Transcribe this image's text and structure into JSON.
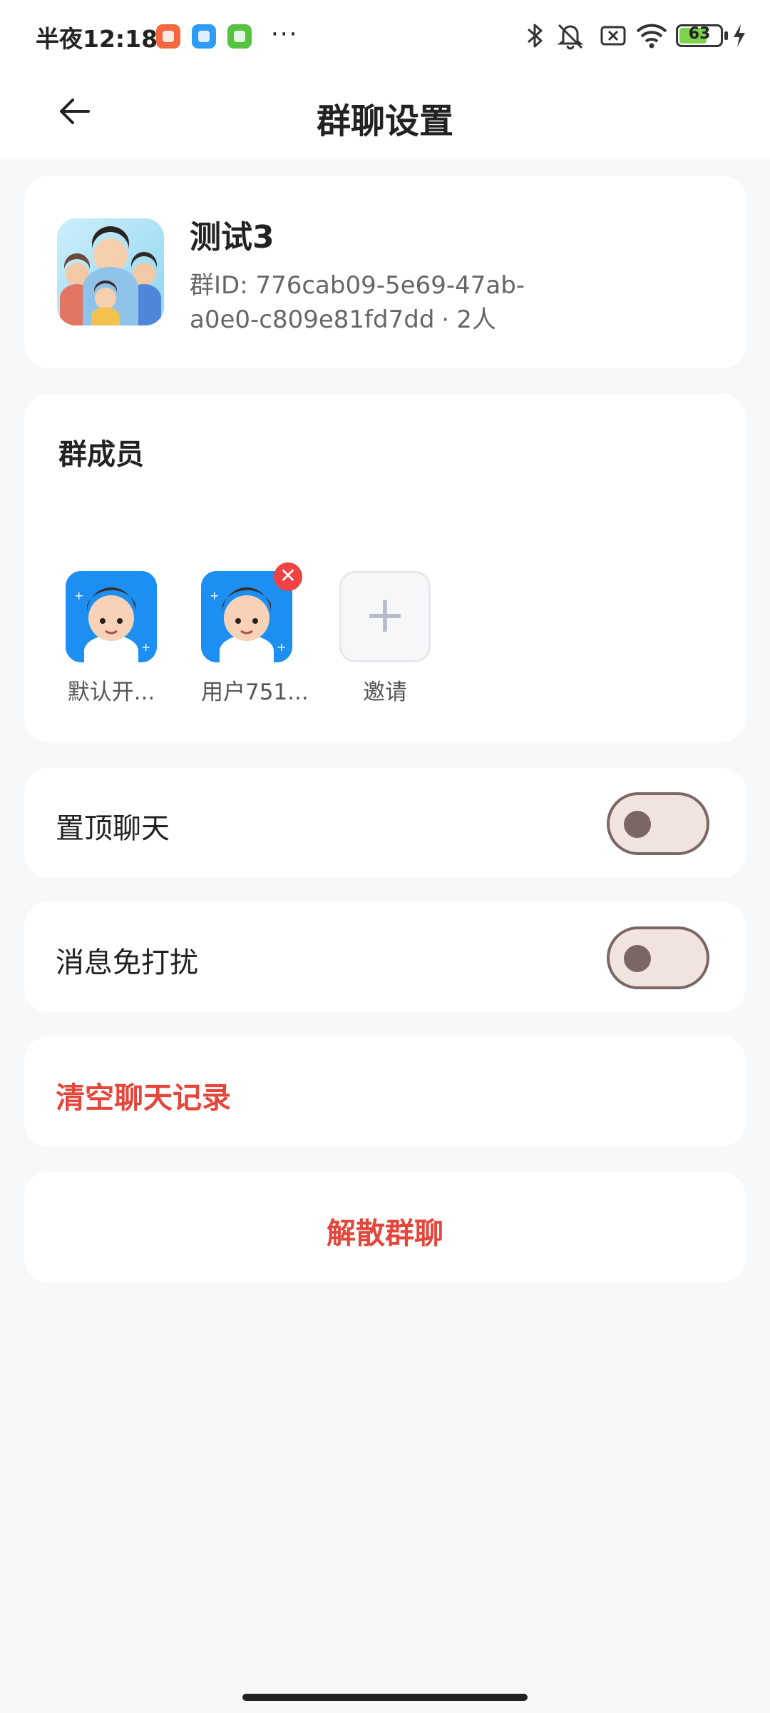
{
  "status_bar": {
    "time": "半夜12:18",
    "more": "···",
    "battery_level": "63",
    "battery_fraction": 0.63,
    "icons": [
      "app-notification-icon",
      "app-notification-icon",
      "app-notification-icon",
      "bluetooth-icon",
      "muted-bell-icon",
      "sim-off-icon",
      "wifi-icon",
      "battery-icon",
      "charging-icon"
    ]
  },
  "header": {
    "title": "群聊设置",
    "back_icon": "back-arrow-icon"
  },
  "group": {
    "name": "测试3",
    "id_label": "群ID: 776cab09-5e69-47ab-a0e0-c809e81fd7dd",
    "separator": "·",
    "member_count": "2人"
  },
  "members": {
    "title": "群成员",
    "items": [
      {
        "name": "默认开..."
      },
      {
        "name": "用户751..."
      }
    ],
    "invite_label": "邀请",
    "invite_symbol": "+",
    "remove_symbol": "✕"
  },
  "settings": {
    "pin_label": "置顶聊天",
    "pin_on": false,
    "mute_label": "消息免打扰",
    "mute_on": false
  },
  "actions": {
    "clear_label": "清空聊天记录",
    "dissolve_label": "解散群聊"
  },
  "colors": {
    "accent_danger": "#e4463b",
    "toggle_off_track": "#f1e3dd",
    "toggle_off_border": "#7a6764",
    "page_background": "#f7f8fa",
    "avatar_blue": "#1d8ff2"
  }
}
